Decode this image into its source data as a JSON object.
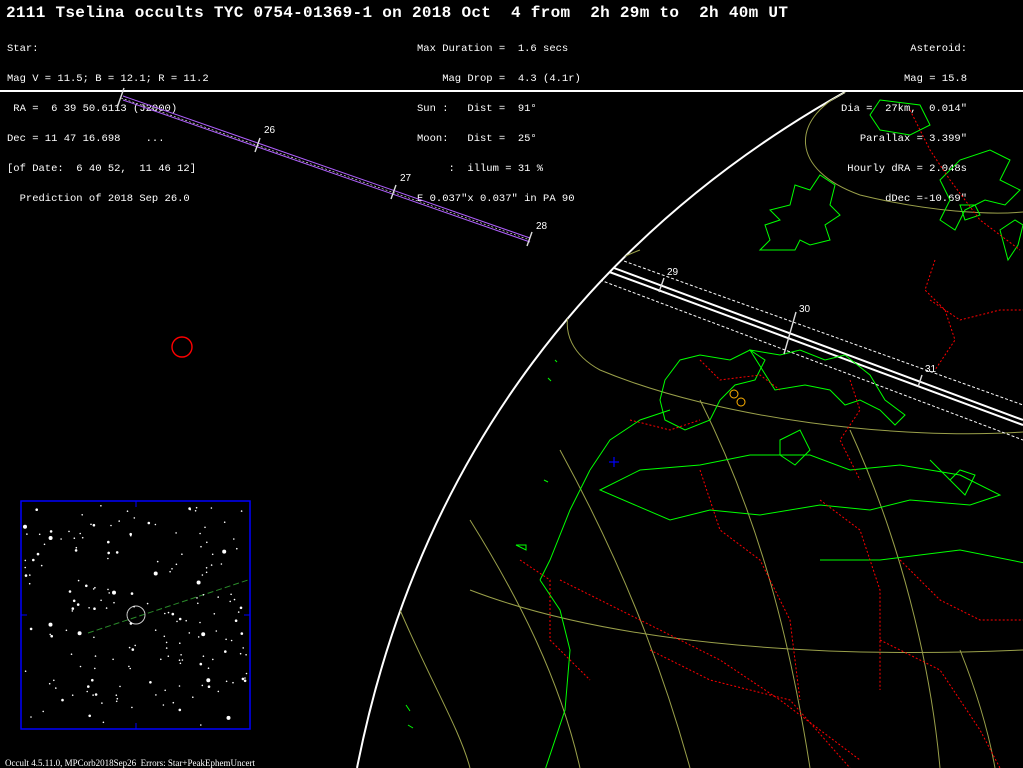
{
  "title": "2111 Tselina occults TYC 0754-01369-1 on 2018 Oct  4 from  2h 29m to  2h 40m UT",
  "star_block": [
    "Star:",
    "Mag V = 11.5; B = 12.1; R = 11.2",
    " RA =  6 39 50.6113 (J2000)",
    "Dec = 11 47 16.698    ...",
    "[of Date:  6 40 52,  11 46 12]",
    "  Prediction of 2018 Sep 26.0"
  ],
  "event_block": [
    "Max Duration =  1.6 secs",
    "    Mag Drop =  4.3 (4.1r)",
    "Sun :   Dist =  91°",
    "Moon:   Dist =  25°",
    "     :  illum = 31 %",
    "E 0.037\"x 0.037\" in PA 90"
  ],
  "asteroid_block": [
    "Asteroid:",
    "Mag = 15.8",
    "Dia =  27km,  0.014\"",
    "Parallax = 3.399\"",
    "Hourly dRA = 2.048s",
    "dDec =-10.69\""
  ],
  "path_time_labels": [
    "26",
    "27",
    "28",
    "29",
    "30",
    "31"
  ],
  "footer": "Occult 4.5.11.0, MPCorb2018Sep26  Errors: Star+PeakEphemUncert",
  "colors": {
    "coastline": "#00ff00",
    "borders": "#ff0000",
    "graticule": "#9aa04a",
    "limb": "#ffffff",
    "path_edges": "#b060ff",
    "finder_frame": "#0000ff"
  },
  "icons": [
    "site-marker-circle",
    "target-star-circle",
    "sub-point-cross"
  ]
}
